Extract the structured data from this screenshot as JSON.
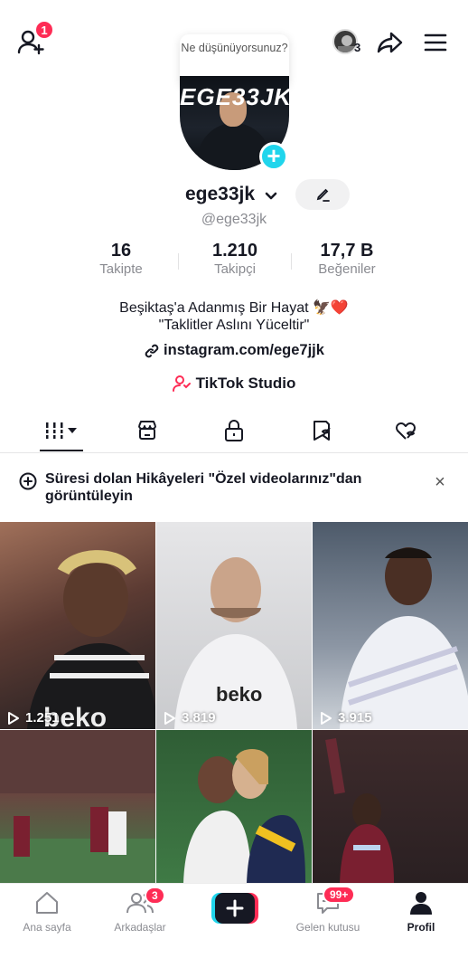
{
  "header": {
    "notification_count": "1",
    "bubble_text": "Ne düşünüyorsunuz?",
    "stories_count": "3"
  },
  "profile": {
    "avatar_text": "EGE33JK",
    "username": "ege33jk",
    "handle": "@ege33jk",
    "stats": [
      {
        "value": "16",
        "label": "Takipte"
      },
      {
        "value": "1.210",
        "label": "Takipçi"
      },
      {
        "value": "17,7 B",
        "label": "Beğeniler"
      }
    ],
    "bio_line1": "Beşiktaş'a Adanmış Bir Hayat 🦅❤️",
    "bio_line2": "\"Taklitler Aslını Yüceltir\"",
    "link": "instagram.com/ege7jjk",
    "studio": "TikTok Studio"
  },
  "tabs": [
    "videos-grid",
    "shop",
    "private",
    "favorites",
    "liked"
  ],
  "banner": {
    "text": "Süresi dolan Hikâyeleri \"Özel videolarınız\"dan görüntüleyin",
    "close": "×"
  },
  "videos": [
    {
      "views": "1.251",
      "bg": "#6b4a3f"
    },
    {
      "views": "3.819",
      "bg": "#d8d8da"
    },
    {
      "views": "3.915",
      "bg": "#aeb6c0"
    },
    {
      "views": "",
      "bg": "#5a3a38"
    },
    {
      "views": "",
      "bg": "#3d6a42"
    },
    {
      "views": "",
      "bg": "#3a2a2c"
    }
  ],
  "bottom_nav": {
    "home": "Ana sayfa",
    "friends": "Arkadaşlar",
    "friends_badge": "3",
    "inbox": "Gelen kutusu",
    "inbox_badge": "99+",
    "profile": "Profil"
  },
  "colors": {
    "accent": "#fe2c55",
    "cyan": "#20d5ec",
    "text": "#161823",
    "muted": "#8a8b91"
  }
}
